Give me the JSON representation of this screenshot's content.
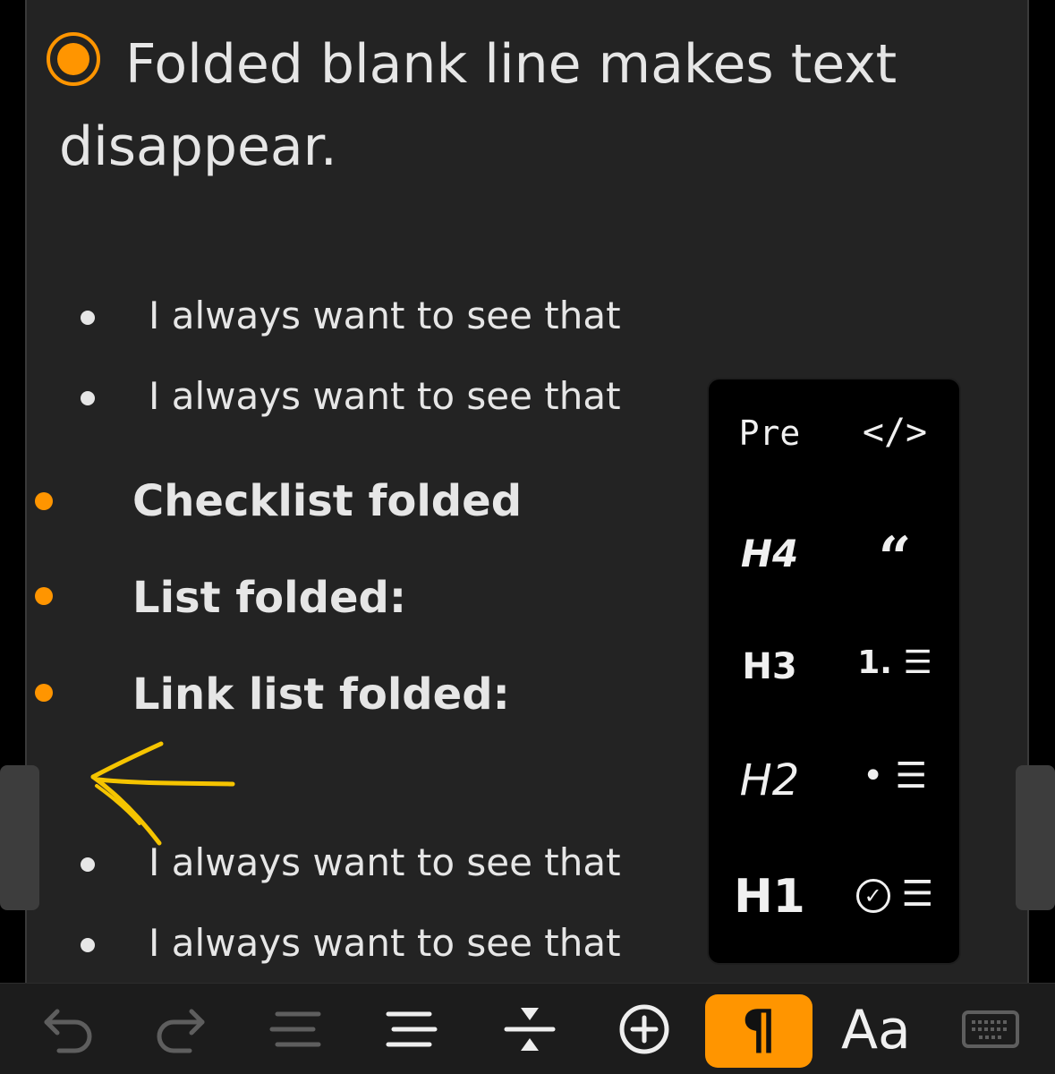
{
  "note": {
    "title": "Folded blank line makes text disappear.",
    "bullets_top": [
      "I always want to see that",
      "I always want to see that"
    ],
    "folded_headings": [
      "Checklist folded",
      "List folded:",
      "Link list folded:"
    ],
    "bullets_bottom": [
      "I always want to see that",
      "I always want to see that"
    ]
  },
  "format_popup": {
    "pre": "Pre",
    "code": "</>",
    "h4": "H4",
    "quote": "“",
    "h3": "H3",
    "numbered_list": "1.",
    "h2": "H2",
    "bullet_list": "•",
    "h1": "H1",
    "checklist": "✓"
  },
  "toolbar": {
    "paragraph": "¶",
    "text_style": "Aa",
    "icons": [
      "undo-icon",
      "redo-icon",
      "outdent-icon",
      "indent-icon",
      "collapse-icon",
      "add-icon",
      "paragraph-icon",
      "text-style-icon",
      "keyboard-icon"
    ],
    "active_color": "#ff9500"
  },
  "colors": {
    "accent": "#ff9500",
    "annotation": "#f5c400",
    "background": "#232323"
  }
}
